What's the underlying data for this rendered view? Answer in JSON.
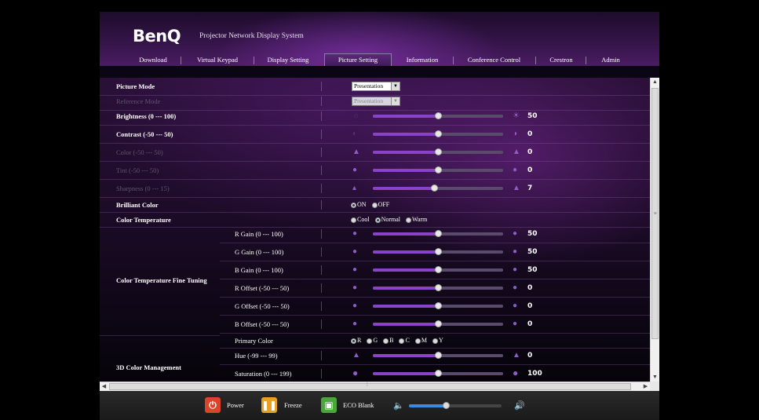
{
  "header": {
    "logo": "BenQ",
    "title": "Projector Network Display System"
  },
  "nav": {
    "items": [
      {
        "label": "Download"
      },
      {
        "label": "Virtual Keypad"
      },
      {
        "label": "Display Setting"
      },
      {
        "label": "Picture Setting"
      },
      {
        "label": "Information"
      },
      {
        "label": "Conference Control"
      },
      {
        "label": "Crestron"
      },
      {
        "label": "Admin"
      }
    ],
    "active": "Picture Setting"
  },
  "settings": {
    "picture_mode": {
      "label": "Picture Mode",
      "value": "Presentation"
    },
    "reference_mode": {
      "label": "Reference Mode",
      "value": "Presentation"
    },
    "brightness": {
      "label": "Brightness (0 --- 100)",
      "value": "50",
      "level": 0.5
    },
    "contrast": {
      "label": "Contrast (-50 --- 50)",
      "value": "0",
      "level": 0.5
    },
    "color": {
      "label": "Color (-50 --- 50)",
      "value": "0",
      "level": 0.5
    },
    "tint": {
      "label": "Tint (-50 --- 50)",
      "value": "0",
      "level": 0.5
    },
    "sharpness": {
      "label": "Sharpness (0 --- 15)",
      "value": "7",
      "level": 0.467
    },
    "brilliant_color": {
      "label": "Brilliant Color",
      "options": [
        "ON",
        "OFF"
      ],
      "selected": "ON"
    },
    "color_temperature": {
      "label": "Color Temperature",
      "options": [
        "Cool",
        "Normal",
        "Warm"
      ],
      "selected": "Normal"
    }
  },
  "fine_tuning": {
    "label": "Color Temperature Fine Tuning",
    "r_gain": {
      "label": "R Gain (0 --- 100)",
      "value": "50",
      "level": 0.5
    },
    "g_gain": {
      "label": "G Gain (0 --- 100)",
      "value": "50",
      "level": 0.5
    },
    "b_gain": {
      "label": "B Gain (0 --- 100)",
      "value": "50",
      "level": 0.5
    },
    "r_offset": {
      "label": "R Offset (-50 --- 50)",
      "value": "0",
      "level": 0.5
    },
    "g_offset": {
      "label": "G Offset (-50 --- 50)",
      "value": "0",
      "level": 0.5
    },
    "b_offset": {
      "label": "B Offset (-50 --- 50)",
      "value": "0",
      "level": 0.5
    }
  },
  "color_mgmt": {
    "label": "3D Color Management",
    "primary_color": {
      "label": "Primary Color",
      "options": [
        "R",
        "G",
        "B",
        "C",
        "M",
        "Y"
      ],
      "selected": "R"
    },
    "hue": {
      "label": "Hue (-99 --- 99)",
      "value": "0",
      "level": 0.5
    },
    "saturation": {
      "label": "Saturation (0 --- 199)",
      "value": "100",
      "level": 0.5
    }
  },
  "footer": {
    "power": "Power",
    "freeze": "Freeze",
    "eco_blank": "ECO Blank",
    "volume_level": 0.4
  },
  "colors": {
    "accent": "#8a42c8",
    "power": "#d9442a",
    "freeze": "#e8a020",
    "eco": "#4aa83a",
    "volume": "#3a8ae0"
  }
}
